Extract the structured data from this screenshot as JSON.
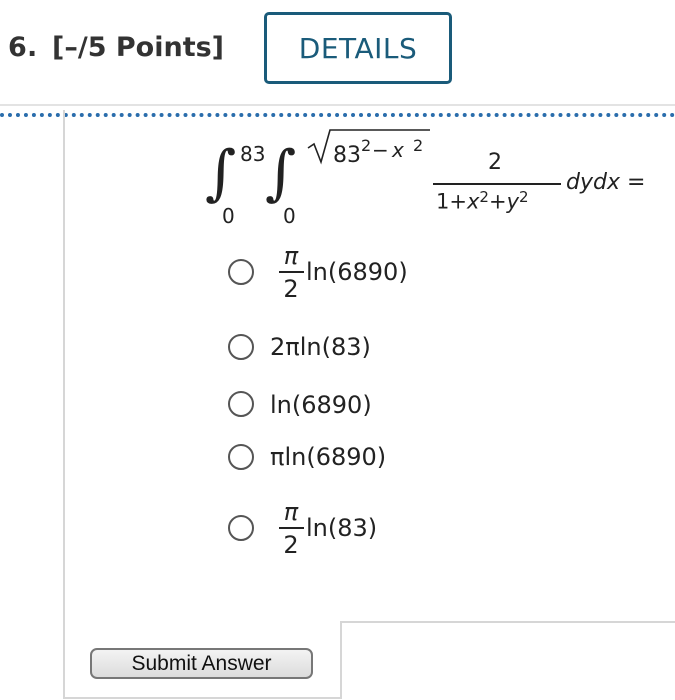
{
  "question": {
    "number": "6.",
    "points": "[–/5 Points]",
    "details_label": "DETAILS"
  },
  "integral": {
    "outer_upper": "83",
    "outer_lower": "0",
    "inner_lower": "0",
    "sqrt_expr_base": "83",
    "sqrt_expr_exp": "2",
    "sqrt_expr_minus": "−",
    "sqrt_expr_var": "x",
    "sqrt_expr_var_exp": "2",
    "numerator": "2",
    "denominator_a": "1+",
    "denominator_x": "x",
    "denominator_x_exp": "2",
    "denominator_plus": "+",
    "denominator_y": "y",
    "denominator_y_exp": "2",
    "differential": "dydx =",
    "integrand_sign": "∫"
  },
  "options": [
    {
      "frac_num": "π",
      "frac_den": "2",
      "text": "ln(6890)"
    },
    {
      "text_prefix": "2π",
      "text": "ln(83)"
    },
    {
      "text": "ln(6890)"
    },
    {
      "text_prefix": "π",
      "text": "ln(6890)"
    },
    {
      "frac_num": "π",
      "frac_den": "2",
      "text": "ln(83)"
    }
  ],
  "submit_label": "Submit Answer"
}
